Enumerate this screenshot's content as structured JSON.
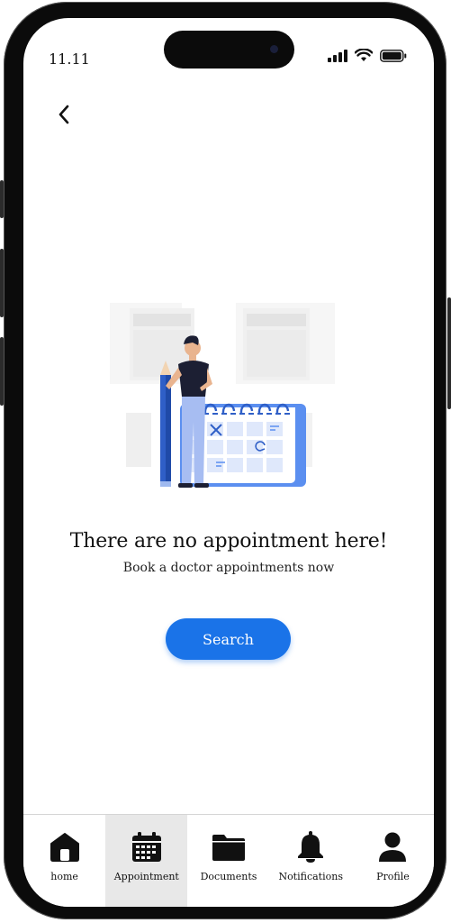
{
  "status_bar": {
    "time": "11.11"
  },
  "empty_state": {
    "title": "There are no appointment here!",
    "subtitle": "Book a doctor appointments now"
  },
  "search_button": {
    "label": "Search"
  },
  "colors": {
    "accent": "#1a73e8",
    "active_tab_bg": "#e8e8e8"
  },
  "nav": {
    "items": [
      {
        "label": "home",
        "icon": "home-icon"
      },
      {
        "label": "Appointment",
        "icon": "calendar-icon",
        "active": true
      },
      {
        "label": "Documents",
        "icon": "folder-icon"
      },
      {
        "label": "Notifications",
        "icon": "bell-icon"
      },
      {
        "label": "Profile",
        "icon": "person-icon"
      }
    ]
  }
}
